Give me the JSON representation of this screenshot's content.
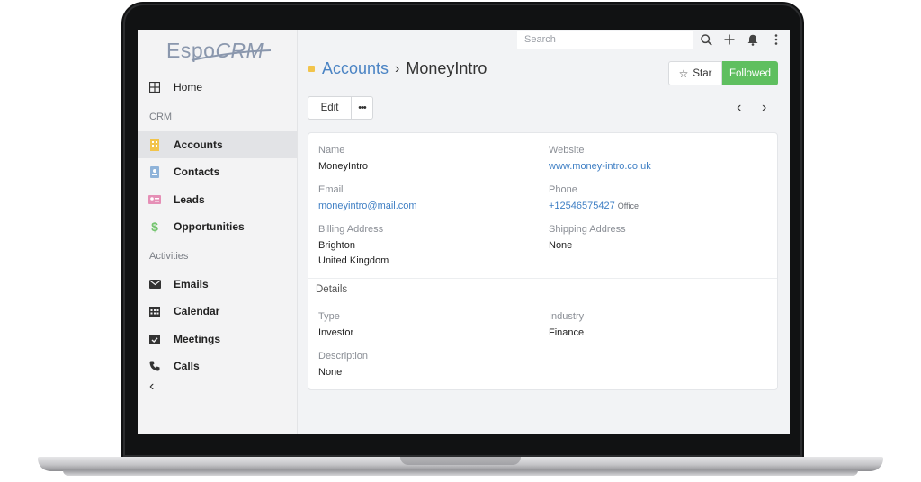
{
  "app": {
    "logo_main": "Espo",
    "logo_crm": "CRM"
  },
  "topbar": {
    "search_placeholder": "Search"
  },
  "sidebar": {
    "home": "Home",
    "section_crm": "CRM",
    "items_crm": [
      {
        "label": "Accounts",
        "icon": "building-icon",
        "color": "#f2c44b"
      },
      {
        "label": "Contacts",
        "icon": "contact-card-icon",
        "color": "#8fb3d9"
      },
      {
        "label": "Leads",
        "icon": "id-card-icon",
        "color": "#e58fb6"
      },
      {
        "label": "Opportunities",
        "icon": "dollar-icon",
        "color": "#74c46e"
      }
    ],
    "section_activities": "Activities",
    "items_activities": [
      {
        "label": "Emails",
        "icon": "envelope-icon"
      },
      {
        "label": "Calendar",
        "icon": "calendar-icon"
      },
      {
        "label": "Meetings",
        "icon": "calendar-check-icon"
      },
      {
        "label": "Calls",
        "icon": "phone-icon"
      }
    ]
  },
  "header": {
    "breadcrumb_link": "Accounts",
    "separator": "›",
    "title": "MoneyIntro",
    "star_label": "Star",
    "followed_label": "Followed",
    "edit_label": "Edit",
    "more_label": "•••"
  },
  "record": {
    "name_label": "Name",
    "name_value": "MoneyIntro",
    "website_label": "Website",
    "website_value": "www.money-intro.co.uk",
    "email_label": "Email",
    "email_value": "moneyintro@mail.com",
    "phone_label": "Phone",
    "phone_value": "+12546575427",
    "phone_type": "Office",
    "billing_label": "Billing Address",
    "billing_line1": "Brighton",
    "billing_line2": "United Kingdom",
    "shipping_label": "Shipping Address",
    "shipping_value": "None",
    "details_title": "Details",
    "type_label": "Type",
    "type_value": "Investor",
    "industry_label": "Industry",
    "industry_value": "Finance",
    "description_label": "Description",
    "description_value": "None"
  },
  "colors": {
    "accent_link": "#4b84c4",
    "followed_green": "#5fbf5f"
  }
}
